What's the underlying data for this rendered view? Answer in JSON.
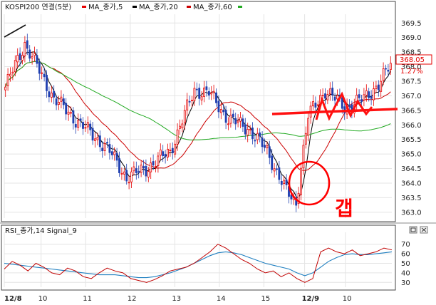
{
  "legend": {
    "symbol": "KOSPI200 연결(5분)",
    "ma5": "MA_종가,5",
    "ma20": "MA_종가,20",
    "ma60": "MA_종가,60",
    "rsi": "RSI_종가,14  Signal_9"
  },
  "colors": {
    "candle_up": "#e60000",
    "candle_down": "#1f3fb0",
    "ma5": "#000000",
    "ma20": "#cc0000",
    "ma60": "#22aa22",
    "rsi": "#c00000",
    "signal": "#1f7fc0",
    "annotation": "#ff0000",
    "price_box": "#ffffff",
    "price_text": "#e60000"
  },
  "price_badge": {
    "price": "368.05",
    "change": "1.27%"
  },
  "annotation_text": "갭",
  "chart_data": [
    {
      "type": "candlestick",
      "title": "KOSPI200 연결(5분)",
      "ylim": [
        362.8,
        369.8
      ],
      "y_ticks": [
        363.0,
        363.5,
        364.0,
        364.5,
        365.0,
        365.5,
        366.0,
        366.5,
        367.0,
        367.5,
        368.0,
        368.5,
        369.0,
        369.5
      ],
      "x_ticks": [
        "12/8",
        "10",
        "11",
        "12",
        "13",
        "14",
        "15",
        "12/9",
        "10"
      ],
      "bar_count": 160,
      "key_points": [
        {
          "bar": 0,
          "close": 367.3
        },
        {
          "bar": 8,
          "close": 368.8
        },
        {
          "bar": 20,
          "close": 366.9
        },
        {
          "bar": 30,
          "close": 366.1
        },
        {
          "bar": 42,
          "close": 365.2
        },
        {
          "bar": 50,
          "close": 364.2
        },
        {
          "bar": 58,
          "close": 364.5
        },
        {
          "bar": 68,
          "close": 365.1
        },
        {
          "bar": 78,
          "close": 367.2
        },
        {
          "bar": 84,
          "close": 367.1
        },
        {
          "bar": 92,
          "close": 366.2
        },
        {
          "bar": 100,
          "close": 365.9
        },
        {
          "bar": 108,
          "close": 365.1
        },
        {
          "bar": 116,
          "close": 363.7
        },
        {
          "bar": 120,
          "close": 363.3
        },
        {
          "bar": 122,
          "close": 364.6
        },
        {
          "bar": 125,
          "close": 366.3
        },
        {
          "bar": 132,
          "close": 367.2
        },
        {
          "bar": 140,
          "close": 366.6
        },
        {
          "bar": 148,
          "close": 366.9
        },
        {
          "bar": 154,
          "close": 367.4
        },
        {
          "bar": 159,
          "close": 368.05
        }
      ],
      "series": [
        {
          "name": "MA_종가,5"
        },
        {
          "name": "MA_종가,20"
        },
        {
          "name": "MA_종가,60"
        }
      ]
    },
    {
      "type": "line",
      "title": "RSI_종가,14  Signal_9",
      "ylim": [
        25,
        75
      ],
      "y_ticks": [
        30,
        40,
        50,
        60,
        70
      ],
      "x_ticks": [
        "12/8",
        "10",
        "11",
        "12",
        "13",
        "14",
        "15",
        "12/9",
        "10"
      ],
      "series": [
        {
          "name": "RSI",
          "values": [
            44,
            52,
            48,
            42,
            50,
            46,
            40,
            38,
            45,
            42,
            36,
            34,
            40,
            45,
            42,
            40,
            34,
            32,
            30,
            33,
            37,
            42,
            44,
            46,
            50,
            56,
            62,
            70,
            66,
            60,
            54,
            50,
            44,
            40,
            42,
            36,
            40,
            34,
            30,
            34,
            62,
            66,
            62,
            60,
            64,
            58,
            60,
            62,
            66,
            64
          ]
        },
        {
          "name": "Signal",
          "values": [
            50,
            49,
            48,
            47,
            46,
            45,
            44,
            43,
            42,
            41,
            40,
            39,
            38,
            38,
            38,
            37,
            36,
            35,
            35,
            36,
            38,
            40,
            43,
            46,
            50,
            54,
            58,
            61,
            62,
            61,
            59,
            56,
            53,
            50,
            48,
            46,
            44,
            40,
            37,
            40,
            46,
            52,
            56,
            59,
            60,
            59,
            59,
            60,
            61,
            62
          ]
        }
      ]
    }
  ]
}
